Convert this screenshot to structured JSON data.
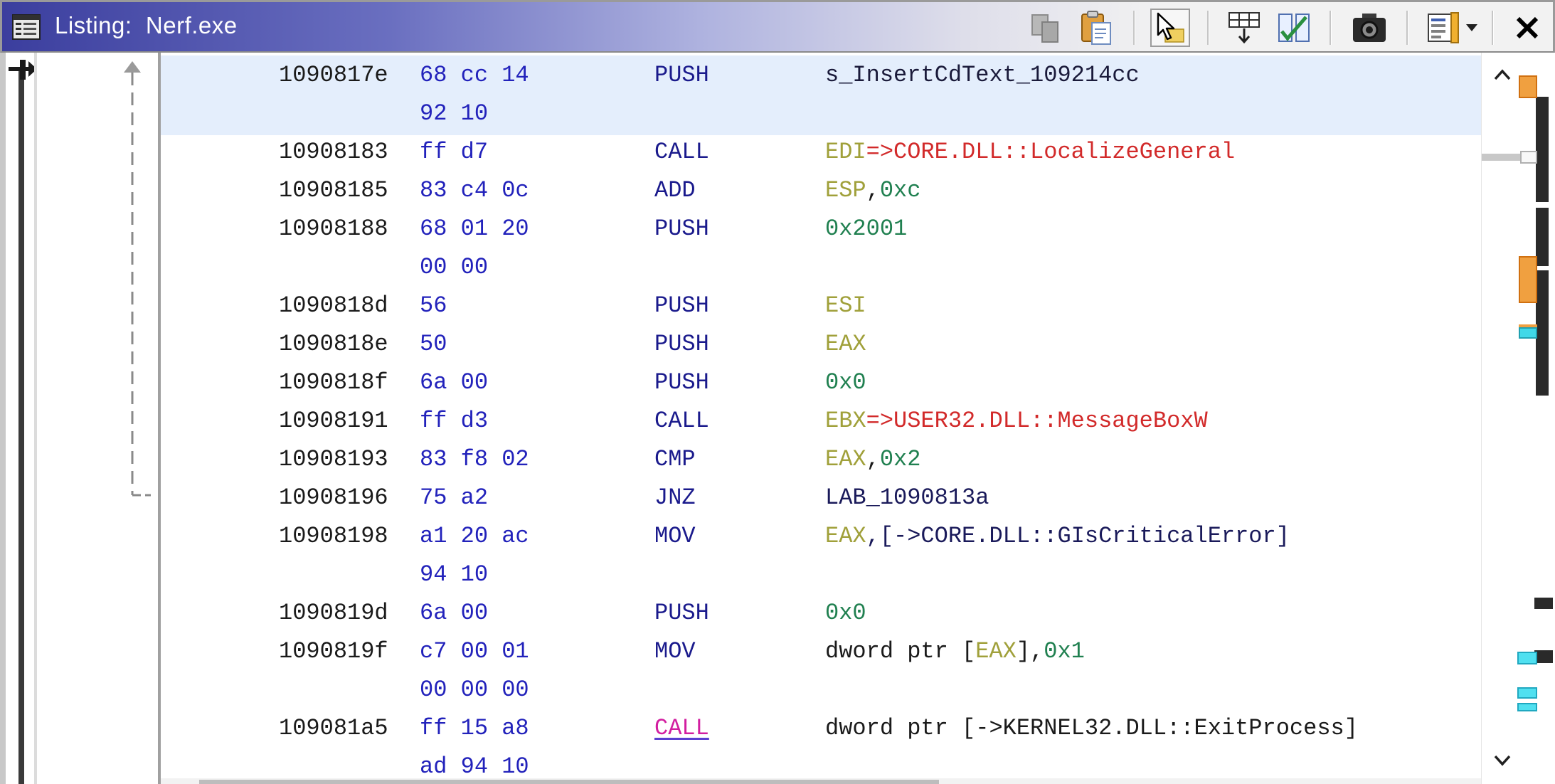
{
  "window": {
    "title": "Listing:  Nerf.exe",
    "title_icon": "listing-window-icon"
  },
  "toolbar": {
    "buttons": [
      {
        "id": "copy",
        "icon": "copy-icon"
      },
      {
        "id": "paste",
        "icon": "paste-icon"
      },
      {
        "id": "cursor-tracking",
        "icon": "cursor-select-icon",
        "active": true
      },
      {
        "id": "field-header",
        "icon": "field-header-icon"
      },
      {
        "id": "diff-view",
        "icon": "diff-view-icon"
      },
      {
        "id": "snapshot",
        "icon": "camera-icon"
      },
      {
        "id": "display-options",
        "icon": "display-options-icon"
      },
      {
        "id": "display-options-menu",
        "icon": "chevron-down-icon"
      },
      {
        "id": "close",
        "icon": "close-icon"
      }
    ]
  },
  "listing": {
    "rows": [
      {
        "addr": "1090817e",
        "bytes": "68 cc 14",
        "mnemonic": "PUSH",
        "operands": [
          {
            "t": "s_InsertCdText_109214cc",
            "k": "str"
          }
        ],
        "selected": true
      },
      {
        "addr": "",
        "bytes": "92 10",
        "mnemonic": "",
        "operands": [],
        "selected": true
      },
      {
        "addr": "10908183",
        "bytes": "ff d7",
        "mnemonic": "CALL",
        "operands": [
          {
            "t": "EDI",
            "k": "reg"
          },
          {
            "t": "=>CORE.DLL::LocalizeGeneral",
            "k": "ext"
          }
        ]
      },
      {
        "addr": "10908185",
        "bytes": "83 c4 0c",
        "mnemonic": "ADD",
        "operands": [
          {
            "t": "ESP",
            "k": "reg"
          },
          {
            "t": ",",
            "k": "plain"
          },
          {
            "t": "0xc",
            "k": "num"
          }
        ]
      },
      {
        "addr": "10908188",
        "bytes": "68 01 20",
        "mnemonic": "PUSH",
        "operands": [
          {
            "t": "0x2001",
            "k": "num"
          }
        ]
      },
      {
        "addr": "",
        "bytes": "00 00",
        "mnemonic": "",
        "operands": []
      },
      {
        "addr": "1090818d",
        "bytes": "56",
        "mnemonic": "PUSH",
        "operands": [
          {
            "t": "ESI",
            "k": "reg"
          }
        ]
      },
      {
        "addr": "1090818e",
        "bytes": "50",
        "mnemonic": "PUSH",
        "operands": [
          {
            "t": "EAX",
            "k": "reg"
          }
        ]
      },
      {
        "addr": "1090818f",
        "bytes": "6a 00",
        "mnemonic": "PUSH",
        "operands": [
          {
            "t": "0x0",
            "k": "num"
          }
        ]
      },
      {
        "addr": "10908191",
        "bytes": "ff d3",
        "mnemonic": "CALL",
        "operands": [
          {
            "t": "EBX",
            "k": "reg"
          },
          {
            "t": "=>USER32.DLL::MessageBoxW",
            "k": "ext"
          }
        ]
      },
      {
        "addr": "10908193",
        "bytes": "83 f8 02",
        "mnemonic": "CMP",
        "operands": [
          {
            "t": "EAX",
            "k": "reg"
          },
          {
            "t": ",",
            "k": "plain"
          },
          {
            "t": "0x2",
            "k": "num"
          }
        ]
      },
      {
        "addr": "10908196",
        "bytes": "75 a2",
        "mnemonic": "JNZ",
        "operands": [
          {
            "t": "LAB_1090813a",
            "k": "lbl"
          }
        ]
      },
      {
        "addr": "10908198",
        "bytes": "a1 20 ac",
        "mnemonic": "MOV",
        "operands": [
          {
            "t": "EAX",
            "k": "reg"
          },
          {
            "t": ",[->CORE.DLL::GIsCriticalError]",
            "k": "lbl"
          }
        ]
      },
      {
        "addr": "",
        "bytes": "94 10",
        "mnemonic": "",
        "operands": []
      },
      {
        "addr": "1090819d",
        "bytes": "6a 00",
        "mnemonic": "PUSH",
        "operands": [
          {
            "t": "0x0",
            "k": "num"
          }
        ]
      },
      {
        "addr": "1090819f",
        "bytes": "c7 00 01",
        "mnemonic": "MOV",
        "operands": [
          {
            "t": "dword ptr [",
            "k": "plain"
          },
          {
            "t": "EAX",
            "k": "reg"
          },
          {
            "t": "],",
            "k": "plain"
          },
          {
            "t": "0x1",
            "k": "num"
          }
        ]
      },
      {
        "addr": "",
        "bytes": "00 00 00",
        "mnemonic": "",
        "operands": []
      },
      {
        "addr": "109081a5",
        "bytes": "ff 15 a8",
        "mnemonic": "CALL",
        "mnemonic_style": "pink",
        "operands": [
          {
            "t": "dword ptr [->KERNEL32.DLL::ExitProcess]",
            "k": "plain"
          }
        ]
      },
      {
        "addr": "",
        "bytes": "ad 94 10",
        "mnemonic": "",
        "operands": []
      }
    ]
  },
  "colors": {
    "address": "#1a1a1a",
    "bytes": "#2222bb",
    "mnemonic": "#1a1a8c",
    "register": "#a0a03a",
    "number": "#208050",
    "external": "#d22a2a",
    "selection": "#e4eefc"
  },
  "overview": {
    "scroll_up_icon": "chevron-up-icon",
    "scroll_down_icon": "chevron-down-icon"
  }
}
